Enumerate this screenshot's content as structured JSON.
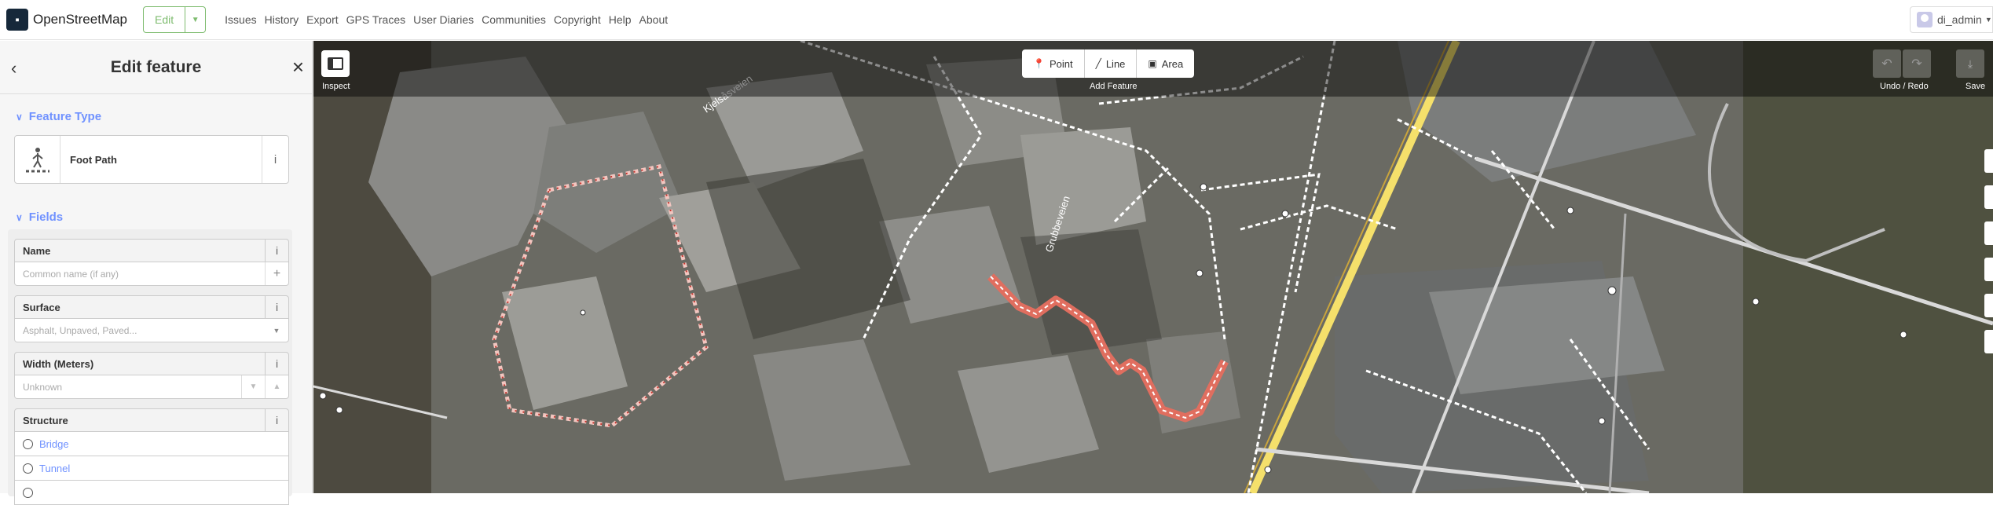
{
  "header": {
    "brand": "OpenStreetMap",
    "edit_label": "Edit",
    "nav": [
      "Issues",
      "History",
      "Export",
      "GPS Traces",
      "User Diaries",
      "Communities",
      "Copyright",
      "Help",
      "About"
    ],
    "username": "di_admin"
  },
  "sidebar": {
    "title": "Edit feature",
    "feature_type_heading": "Feature Type",
    "preset_name": "Foot Path",
    "fields_heading": "Fields",
    "fields": {
      "name": {
        "label": "Name",
        "placeholder": "Common name (if any)"
      },
      "surface": {
        "label": "Surface",
        "placeholder": "Asphalt, Unpaved, Paved..."
      },
      "width": {
        "label": "Width (Meters)",
        "placeholder": "Unknown"
      },
      "structure": {
        "label": "Structure",
        "options": [
          "Bridge",
          "Tunnel"
        ]
      }
    },
    "info_glyph": "i"
  },
  "toolbar": {
    "inspect_caption": "Inspect",
    "add_feature_caption": "Add Feature",
    "modes": [
      "Point",
      "Line",
      "Area"
    ],
    "undo_redo_caption": "Undo / Redo",
    "save_caption": "Save"
  },
  "map": {
    "street_labels": [
      "Kjelsåsveien",
      "Grubbeveien"
    ],
    "selected_color": "#e06e5f",
    "path_color": "#ffffff",
    "road_color": "#f5e06b"
  },
  "icons": [
    "openstreetmap-logo-icon",
    "caret-down-icon",
    "user-avatar-icon",
    "back-icon",
    "close-icon",
    "chevron-down-icon",
    "foot-path-icon",
    "info-icon",
    "plus-icon",
    "inspect-icon",
    "point-icon",
    "line-icon",
    "area-icon",
    "undo-icon",
    "redo-icon",
    "save-icon"
  ]
}
